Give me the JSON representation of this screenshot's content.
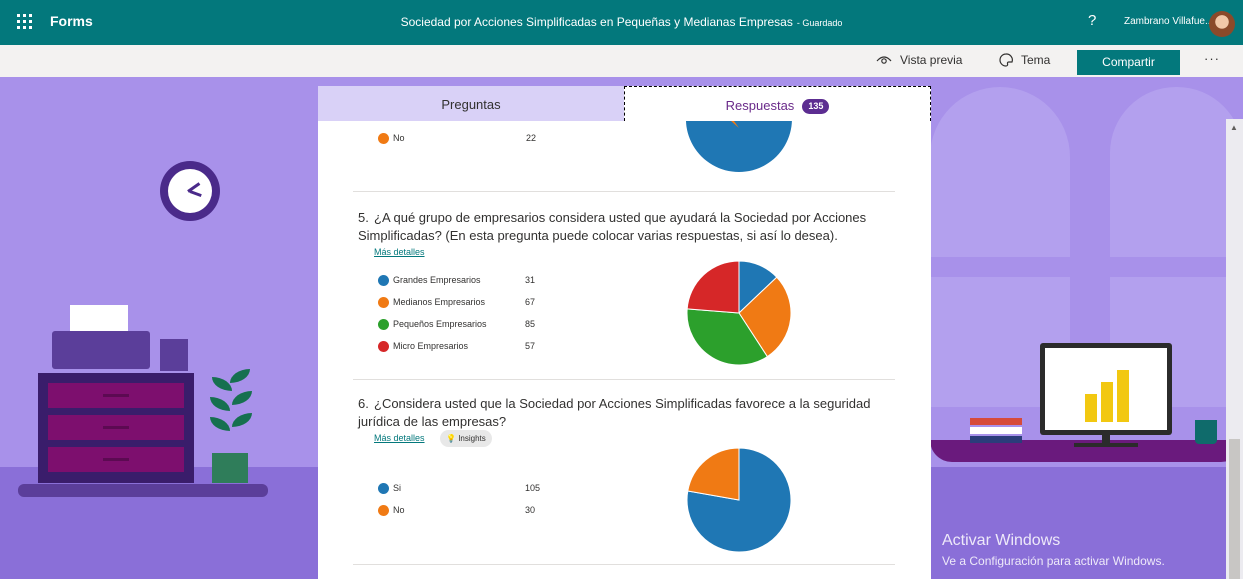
{
  "app": {
    "name": "Forms",
    "title": "Sociedad por Acciones Simplificadas en Pequeñas y Medianas Empresas",
    "save_status": "- Guardado",
    "help": "?",
    "user": "Zambrano Villafue..."
  },
  "commandbar": {
    "preview": "Vista previa",
    "theme": "Tema",
    "share": "Compartir",
    "more": "···"
  },
  "tabs": {
    "questions": "Preguntas",
    "responses": "Respuestas",
    "response_count": "135"
  },
  "questions": [
    {
      "id": "q4",
      "legend": [
        {
          "label": "No",
          "count": "22",
          "color": "#f07a14"
        }
      ],
      "chart_data": {
        "type": "pie",
        "labels": [
          "No"
        ],
        "values": [
          22
        ]
      }
    },
    {
      "id": "q5",
      "number": "5.",
      "text": "¿A qué grupo de empresarios considera usted que ayudará la Sociedad por Acciones Simplificadas? (En esta pregunta puede colocar varias respuestas, si así lo desea).",
      "more_details": "Más detalles",
      "legend": [
        {
          "label": "Grandes Empresarios",
          "count": "31",
          "color": "#1f77b4"
        },
        {
          "label": "Medianos Empresarios",
          "count": "67",
          "color": "#f07a14"
        },
        {
          "label": "Pequeños Empresarios",
          "count": "85",
          "color": "#2ca02c"
        },
        {
          "label": "Micro Empresarios",
          "count": "57",
          "color": "#d62728"
        }
      ],
      "chart_data": {
        "type": "pie",
        "labels": [
          "Grandes Empresarios",
          "Medianos Empresarios",
          "Pequeños Empresarios",
          "Micro Empresarios"
        ],
        "values": [
          31,
          67,
          85,
          57
        ]
      }
    },
    {
      "id": "q6",
      "number": "6.",
      "text": "¿Considera usted que la Sociedad por Acciones Simplificadas favorece a la seguridad jurídica de las empresas?",
      "more_details": "Más detalles",
      "insights": "Insights",
      "legend": [
        {
          "label": "Si",
          "count": "105",
          "color": "#1f77b4"
        },
        {
          "label": "No",
          "count": "30",
          "color": "#f07a14"
        }
      ],
      "chart_data": {
        "type": "pie",
        "labels": [
          "Si",
          "No"
        ],
        "values": [
          105,
          30
        ]
      }
    }
  ],
  "watermark": {
    "line1": "Activar Windows",
    "line2": "Ve a Configuración para activar Windows."
  }
}
